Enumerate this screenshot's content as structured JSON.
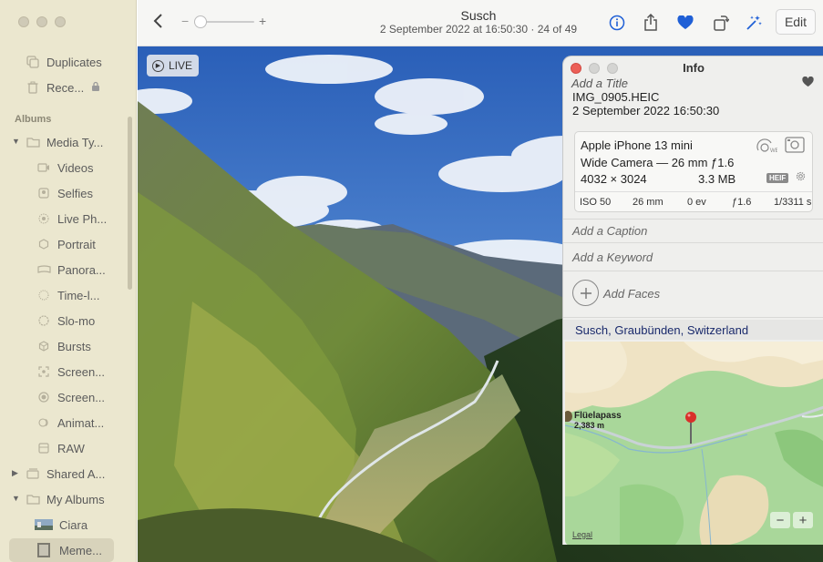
{
  "sidebar": {
    "top_items": [
      {
        "label": "Duplicates",
        "icon": "duplicates-icon"
      },
      {
        "label": "Rece...",
        "icon": "trash-icon",
        "locked": true
      }
    ],
    "albums_header": "Albums",
    "media_types": {
      "label": "Media Ty...",
      "items": [
        {
          "label": "Videos",
          "icon": "video-icon"
        },
        {
          "label": "Selfies",
          "icon": "selfie-icon"
        },
        {
          "label": "Live Ph...",
          "icon": "live-photo-icon"
        },
        {
          "label": "Portrait",
          "icon": "portrait-icon"
        },
        {
          "label": "Panora...",
          "icon": "panorama-icon"
        },
        {
          "label": "Time-l...",
          "icon": "timelapse-icon"
        },
        {
          "label": "Slo-mo",
          "icon": "slomo-icon"
        },
        {
          "label": "Bursts",
          "icon": "bursts-icon"
        },
        {
          "label": "Screen...",
          "icon": "screenshot-icon"
        },
        {
          "label": "Screen...",
          "icon": "screen-recording-icon"
        },
        {
          "label": "Animat...",
          "icon": "animated-icon"
        },
        {
          "label": "RAW",
          "icon": "raw-icon"
        }
      ]
    },
    "shared_albums": "Shared A...",
    "my_albums": {
      "label": "My Albums",
      "items": [
        {
          "label": "Ciara",
          "icon": "album-thumb-icon"
        },
        {
          "label": "Meme...",
          "icon": "album-thumb-icon"
        }
      ]
    }
  },
  "toolbar": {
    "title": "Susch",
    "subtitle": "2 September 2022 at 16:50:30  ·  24 of 49",
    "zoom_minus": "−",
    "zoom_plus": "+",
    "edit_label": "Edit"
  },
  "photo": {
    "live_label": "LIVE"
  },
  "info": {
    "title": "Info",
    "add_title": "Add a Title",
    "filename": "IMG_0905.HEIC",
    "datetime": "2 September 2022   16:50:30",
    "camera": {
      "model": "Apple iPhone 13 mini",
      "lens": "Wide Camera — 26 mm ƒ1.6",
      "resolution": "4032 × 3024",
      "filesize": "3.3 MB",
      "format_badge": "HEIF",
      "iso": "ISO 50",
      "focal": "26 mm",
      "ev": "0 ev",
      "aperture": "ƒ1.6",
      "shutter": "1/3311 s"
    },
    "caption_placeholder": "Add a Caption",
    "keyword_placeholder": "Add a Keyword",
    "faces_label": "Add Faces",
    "location": "Susch, Graubünden, Switzerland",
    "map": {
      "place_name": "Flüelapass",
      "place_elevation": "2,383 m",
      "legal": "Legal",
      "zoom_out": "−",
      "zoom_in": "+"
    }
  },
  "colors": {
    "sidebar_bg": "#ebe7cf",
    "accent_blue": "#1f5fd6",
    "map_green": "#a9d79a",
    "map_sand": "#efe3c4",
    "pin_red": "#d9302a"
  }
}
